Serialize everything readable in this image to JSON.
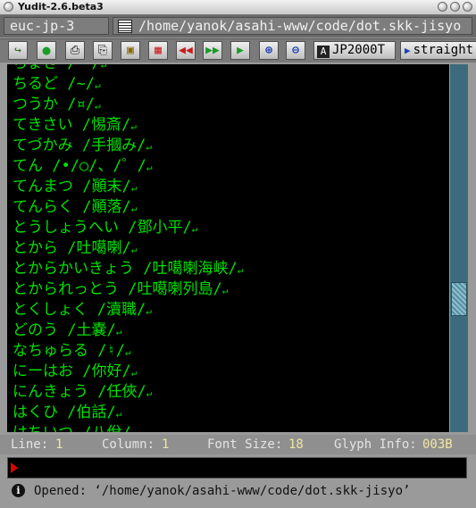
{
  "window": {
    "title": "Yudit-2.6.beta3"
  },
  "header": {
    "encoding": "euc-jp-3",
    "path": "/home/yanok/asahi-www/code/dot.skk-jisyo"
  },
  "toolbar": {
    "buttons": [
      {
        "name": "open-file-button",
        "glyph": "↗"
      },
      {
        "name": "record-button",
        "glyph": "●"
      },
      {
        "name": "print-button",
        "glyph": "⎙"
      },
      {
        "name": "print-preview-button",
        "glyph": "⎘"
      },
      {
        "name": "keyboard-map-button",
        "glyph": "⌨"
      },
      {
        "name": "grid-button",
        "glyph": "▦"
      },
      {
        "name": "rewind-button",
        "glyph": "⏪"
      },
      {
        "name": "fast-forward-button",
        "glyph": "⏩"
      },
      {
        "name": "forward-button",
        "glyph": "▶"
      },
      {
        "name": "zoom-in-button",
        "glyph": "+"
      },
      {
        "name": "zoom-out-button",
        "glyph": "−"
      }
    ],
    "font_button": "JP2000T",
    "direction_button": "straight"
  },
  "editor": {
    "lines": [
      "ちょき /ー/",
      "ちるど /~/",
      "つうか /¤/",
      "てきさい /惕斎/",
      "てづかみ /手摑み/",
      "てん /•/○/、/゜/",
      "てんまつ /顚末/",
      "てんらく /顚落/",
      "とうしょうへい /鄧小平/",
      "とから /吐噶喇/",
      "とからかいきょう /吐噶喇海峡/",
      "とかられっとう /吐噶喇列島/",
      "とくしょく /瀆職/",
      "どのう /土嚢/",
      "なちゅらる /♮/",
      "にーはお /你好/",
      "にんきょう /任俠/",
      "はくひ /伯話/",
      "はちいつ /八佾/"
    ],
    "return_glyph": "↵"
  },
  "status": {
    "line_label": "Line:",
    "line_value": "1",
    "column_label": "Column:",
    "column_value": "1",
    "fontsize_label": "Font Size:",
    "fontsize_value": "18",
    "glyph_label": "Glyph Info:",
    "glyph_value": "003B"
  },
  "message": {
    "icon": "info-icon",
    "text": "Opened: ‘/home/yanok/asahi-www/code/dot.skk-jisyo’"
  },
  "colors": {
    "editor_text": "#00e000",
    "editor_bg": "#000000",
    "status_value": "#f0e7a0",
    "cursor": "#e00000"
  }
}
